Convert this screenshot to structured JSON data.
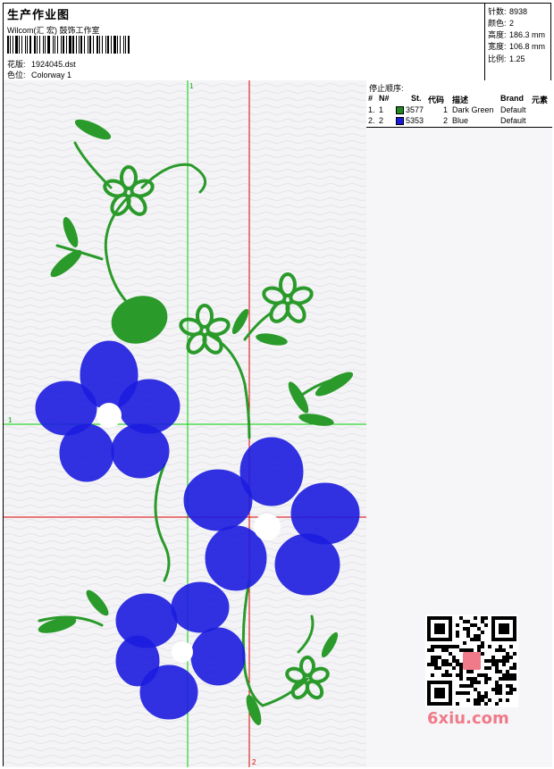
{
  "header": {
    "title": "生产作业图",
    "company": "Wilcom(汇 宏) 鼓饰工作室",
    "design_label": "花版:",
    "design_file": "1924045.dst",
    "colorway_label": "色位:",
    "colorway": "Colorway 1"
  },
  "stats": {
    "stitches_label": "针数:",
    "stitches": "8938",
    "colors_label": "颜色:",
    "colors": "2",
    "height_label": "高度:",
    "height": "186.3 mm",
    "width_label": "宽度:",
    "width": "106.8 mm",
    "scale_label": "比例:",
    "scale": "1.25"
  },
  "sequence": {
    "title": "停止顺序:",
    "columns": [
      "#",
      "N#",
      "St.",
      "代码",
      "描述",
      "Brand",
      "元素"
    ],
    "rows": [
      {
        "idx": "1.",
        "n": "1",
        "color": "#1f8a1f",
        "stitches": "3577",
        "code": "1",
        "desc": "Dark Green",
        "brand": "Default"
      },
      {
        "idx": "2.",
        "n": "2",
        "color": "#1a1adc",
        "stitches": "5353",
        "code": "2",
        "desc": "Blue",
        "brand": "Default"
      }
    ]
  },
  "guides": {
    "v_label": "1",
    "h_label": "1",
    "v2_label": "2"
  },
  "colors": {
    "green": "#2a9a2a",
    "blue": "#1c1ce0",
    "guide_green": "#00cc00",
    "guide_red": "#dd0000"
  },
  "watermark": "6xiu.com"
}
